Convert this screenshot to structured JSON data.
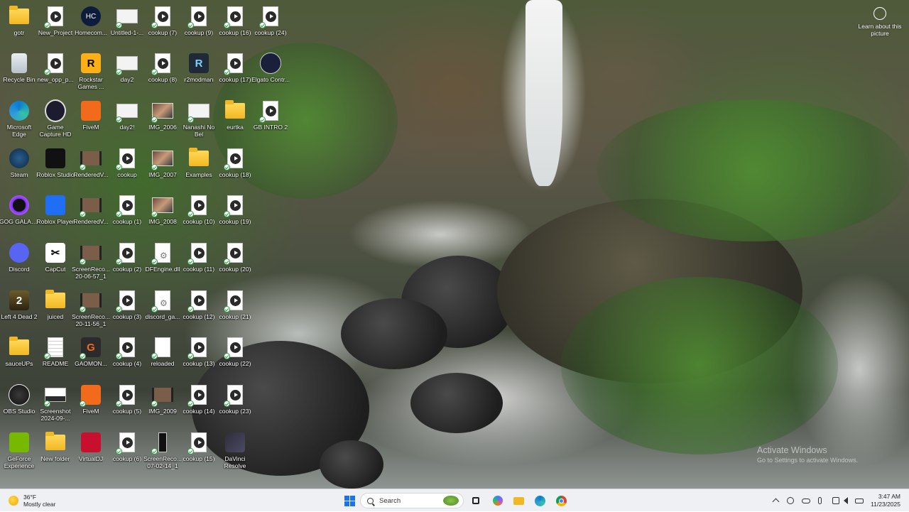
{
  "desktop": {
    "columns": [
      [
        {
          "label": "gotr",
          "icon": "folder-icon",
          "synced": false
        },
        {
          "label": "Recycle Bin",
          "icon": "recycle-bin-icon",
          "synced": false
        },
        {
          "label": "Microsoft Edge",
          "icon": "edge-icon",
          "synced": false
        },
        {
          "label": "Steam",
          "icon": "steam-icon",
          "synced": false
        },
        {
          "label": "GOG GALAXY",
          "icon": "gog-galaxy-icon",
          "synced": false
        },
        {
          "label": "Discord",
          "icon": "discord-icon",
          "synced": false
        },
        {
          "label": "Left 4 Dead 2",
          "icon": "left4dead2-icon",
          "synced": false
        },
        {
          "label": "sauceUPs",
          "icon": "folder-icon",
          "synced": false
        },
        {
          "label": "OBS Studio",
          "icon": "obs-icon",
          "synced": false
        },
        {
          "label": "GeForce Experience",
          "icon": "nvidia-icon",
          "synced": false
        }
      ],
      [
        {
          "label": "New_Project",
          "icon": "video-file-icon",
          "synced": true
        },
        {
          "label": "new_opp_p...",
          "icon": "video-file-icon",
          "synced": true
        },
        {
          "label": "Game Capture HD",
          "icon": "game-capture-icon",
          "synced": false
        },
        {
          "label": "Roblox Studio",
          "icon": "roblox-studio-icon",
          "synced": false
        },
        {
          "label": "Roblox Player",
          "icon": "roblox-player-icon",
          "synced": false
        },
        {
          "label": "CapCut",
          "icon": "capcut-icon",
          "synced": false
        },
        {
          "label": "juiced",
          "icon": "folder-icon",
          "synced": false
        },
        {
          "label": "README",
          "icon": "document-icon",
          "synced": true
        },
        {
          "label": "Screenshot 2024-09-...",
          "icon": "screenshot-icon",
          "synced": true
        },
        {
          "label": "New folder",
          "icon": "folder-icon",
          "synced": false
        }
      ],
      [
        {
          "label": "Homecom...",
          "icon": "homecoming-icon",
          "synced": false
        },
        {
          "label": "Rockstar Games ...",
          "icon": "rockstar-icon",
          "synced": false
        },
        {
          "label": "FiveM",
          "icon": "fivem-icon",
          "synced": false
        },
        {
          "label": "RenderedV...",
          "icon": "film-icon",
          "synced": true
        },
        {
          "label": "RenderedV...",
          "icon": "film-icon",
          "synced": true
        },
        {
          "label": "ScreenReco... 20-06-57_1",
          "icon": "film-icon",
          "synced": true
        },
        {
          "label": "ScreenReco... 20-11-56_1",
          "icon": "film-icon",
          "synced": true
        },
        {
          "label": "GAOMON...",
          "icon": "gaomon-icon",
          "synced": true
        },
        {
          "label": "FiveM",
          "icon": "fivem-icon",
          "synced": true
        },
        {
          "label": "VirtualDJ",
          "icon": "virtualdj-icon",
          "synced": false
        }
      ],
      [
        {
          "label": "Untitled-1-...",
          "icon": "image-file-icon",
          "synced": true
        },
        {
          "label": "day2",
          "icon": "image-file-icon",
          "synced": true
        },
        {
          "label": "day2!",
          "icon": "image-file-icon",
          "synced": true
        },
        {
          "label": "cookup",
          "icon": "video-file-icon",
          "synced": true
        },
        {
          "label": "cookup (1)",
          "icon": "video-file-icon",
          "synced": true
        },
        {
          "label": "cookup (2)",
          "icon": "video-file-icon",
          "synced": true
        },
        {
          "label": "cookup (3)",
          "icon": "video-file-icon",
          "synced": true
        },
        {
          "label": "cookup (4)",
          "icon": "video-file-icon",
          "synced": true
        },
        {
          "label": "cookup (5)",
          "icon": "video-file-icon",
          "synced": true
        },
        {
          "label": "cookup (6)",
          "icon": "video-file-icon",
          "synced": true
        }
      ],
      [
        {
          "label": "cookup (7)",
          "icon": "video-file-icon",
          "synced": true
        },
        {
          "label": "cookup (8)",
          "icon": "video-file-icon",
          "synced": true
        },
        {
          "label": "IMG_2006",
          "icon": "photo-icon",
          "synced": true
        },
        {
          "label": "IMG_2007",
          "icon": "photo-icon",
          "synced": true
        },
        {
          "label": "IMG_2008",
          "icon": "photo-icon",
          "synced": true
        },
        {
          "label": "DFEngine.dll",
          "icon": "dll-file-icon",
          "synced": true
        },
        {
          "label": "discord_ga...",
          "icon": "dll-file-icon",
          "synced": true
        },
        {
          "label": "reloaded",
          "icon": "blank-file-icon",
          "synced": true
        },
        {
          "label": "IMG_2009",
          "icon": "film-icon",
          "synced": true
        },
        {
          "label": "ScreenReco... 07-02-14_1",
          "icon": "phone-recording-icon",
          "synced": true
        }
      ],
      [
        {
          "label": "cookup (9)",
          "icon": "video-file-icon",
          "synced": true
        },
        {
          "label": "r2modman",
          "icon": "r2modman-icon",
          "synced": false
        },
        {
          "label": "Nanashi No Bel",
          "icon": "image-file-icon",
          "synced": true
        },
        {
          "label": "Examples",
          "icon": "folder-icon",
          "synced": false
        },
        {
          "label": "cookup (10)",
          "icon": "video-file-icon",
          "synced": true
        },
        {
          "label": "cookup (11)",
          "icon": "video-file-icon",
          "synced": true
        },
        {
          "label": "cookup (12)",
          "icon": "video-file-icon",
          "synced": true
        },
        {
          "label": "cookup (13)",
          "icon": "video-file-icon",
          "synced": true
        },
        {
          "label": "cookup (14)",
          "icon": "video-file-icon",
          "synced": true
        },
        {
          "label": "cookup (15)",
          "icon": "video-file-icon",
          "synced": true
        }
      ],
      [
        {
          "label": "cookup (16)",
          "icon": "video-file-icon",
          "synced": true
        },
        {
          "label": "cookup (17)",
          "icon": "video-file-icon",
          "synced": true
        },
        {
          "label": "eurtka",
          "icon": "folder-icon",
          "synced": false
        },
        {
          "label": "cookup (18)",
          "icon": "video-file-icon",
          "synced": true
        },
        {
          "label": "cookup (19)",
          "icon": "video-file-icon",
          "synced": true
        },
        {
          "label": "cookup (20)",
          "icon": "video-file-icon",
          "synced": true
        },
        {
          "label": "cookup (21)",
          "icon": "video-file-icon",
          "synced": true
        },
        {
          "label": "cookup (22)",
          "icon": "video-file-icon",
          "synced": true
        },
        {
          "label": "cookup (23)",
          "icon": "video-file-icon",
          "synced": true
        },
        {
          "label": "DaVinci Resolve",
          "icon": "davinci-resolve-icon",
          "synced": false
        }
      ],
      [
        {
          "label": "cookup (24)",
          "icon": "video-file-icon",
          "synced": true
        },
        {
          "label": "Elgato Contr...",
          "icon": "elgato-icon",
          "synced": false
        },
        {
          "label": "GB INTRO 2",
          "icon": "video-file-icon",
          "synced": true
        }
      ]
    ]
  },
  "spotlight": {
    "label": "Learn about this picture",
    "icon": "camera-info-icon"
  },
  "activation": {
    "title": "Activate Windows",
    "subtitle": "Go to Settings to activate Windows."
  },
  "taskbar": {
    "weather": {
      "temp": "36°F",
      "condition": "Mostly clear",
      "icon": "moon-cloud-icon"
    },
    "start_icon": "windows-start-icon",
    "search": {
      "placeholder": "Search"
    },
    "apps": [
      "task-view-icon",
      "copilot-icon",
      "file-explorer-icon",
      "edge-icon",
      "chrome-icon"
    ],
    "tray": [
      "chevron-up-icon",
      "sync-icon",
      "onedrive-icon",
      "microphone-icon",
      "network-icon",
      "volume-icon",
      "battery-icon"
    ],
    "clock": {
      "time": "3:47 AM",
      "date": "11/23/2025"
    }
  }
}
